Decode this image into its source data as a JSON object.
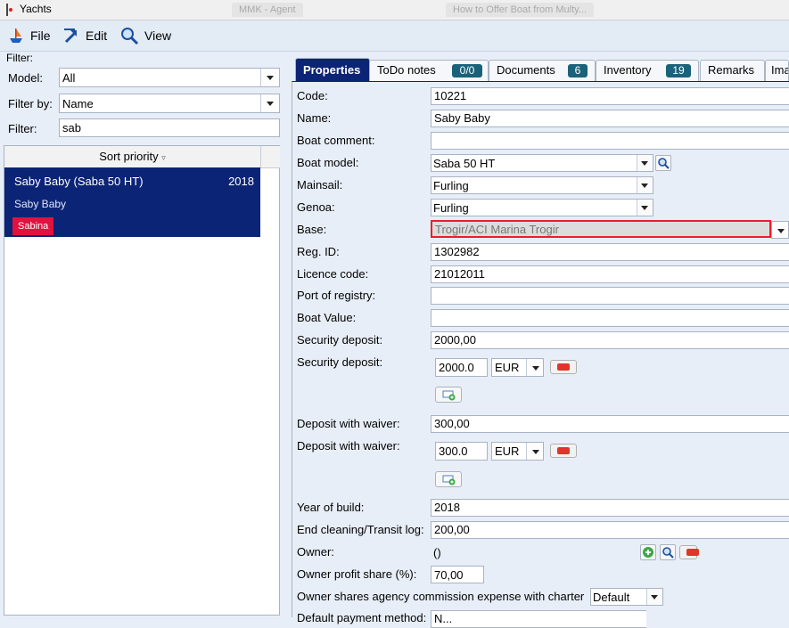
{
  "window": {
    "title": "Yachts",
    "ghost_tabs": [
      "MMK - Agent",
      "How to Offer Boat from Multy..."
    ]
  },
  "toolbar": {
    "file_label": "File",
    "edit_label": "Edit",
    "view_label": "View"
  },
  "filter": {
    "legend": "Filter:",
    "model_label": "Model:",
    "model_value": "All",
    "filter_by_label": "Filter by:",
    "filter_by_value": "Name",
    "filter_label": "Filter:",
    "filter_value": "sab"
  },
  "list": {
    "sort_header": "Sort priority",
    "items": [
      {
        "title": "Saby Baby (Saba 50 HT)",
        "year": "2018",
        "subtitle": "Saby Baby",
        "badge": "Sabina"
      }
    ]
  },
  "tabs": [
    {
      "label": "Properties",
      "active": true
    },
    {
      "label": "ToDo notes",
      "count": "0/0"
    },
    {
      "label": "Documents",
      "count": "6"
    },
    {
      "label": "Inventory",
      "count": "19"
    },
    {
      "label": "Remarks"
    },
    {
      "label": "Ima"
    }
  ],
  "props": {
    "code_label": "Code:",
    "code": "10221",
    "name_label": "Name:",
    "name": "Saby Baby",
    "boat_comment_label": "Boat comment:",
    "boat_comment": "",
    "boat_model_label": "Boat model:",
    "boat_model": "Saba 50 HT",
    "mainsail_label": "Mainsail:",
    "mainsail": "Furling",
    "genoa_label": "Genoa:",
    "genoa": "Furling",
    "base_label": "Base:",
    "base": "Trogir/ACI Marina Trogir",
    "reg_id_label": "Reg. ID:",
    "reg_id": "1302982",
    "licence_label": "Licence code:",
    "licence": "21012011",
    "port_label": "Port of registry:",
    "port": "",
    "boat_value_label": "Boat Value:",
    "boat_value": "",
    "security_deposit_label": "Security deposit:",
    "security_deposit": "2000,00",
    "security_deposit2_label": "Security deposit:",
    "security_amount": "2000.0",
    "security_currency": "EUR",
    "waiver_label": "Deposit with waiver:",
    "waiver": "300,00",
    "waiver2_label": "Deposit with waiver:",
    "waiver_amount": "300.0",
    "waiver_currency": "EUR",
    "year_label": "Year of build:",
    "year": "2018",
    "cleaning_label": "End cleaning/Transit log:",
    "cleaning": "200,00",
    "owner_label": "Owner:",
    "owner": "()",
    "owner_share_label": "Owner profit share (%):",
    "owner_share": "70,00",
    "owner_commission_label": "Owner shares agency commission expense with charter",
    "owner_commission": "Default",
    "payment_label": "Default payment method:",
    "payment": "N..."
  }
}
